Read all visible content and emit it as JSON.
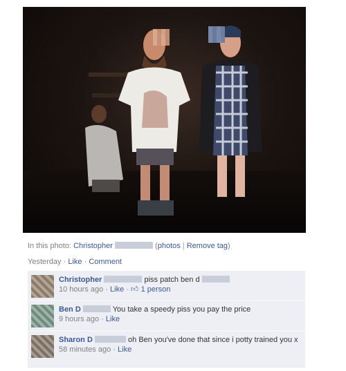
{
  "photo": {
    "alt_tag_caption": "In this photo:",
    "tagged_name": "Christopher",
    "photos_link": "photos",
    "remove_tag_link": "Remove tag"
  },
  "post_actions": {
    "time": "Yesterday",
    "like": "Like",
    "comment": "Comment"
  },
  "comments": [
    {
      "author": "Christopher",
      "text": "piss patch ben d",
      "time": "10 hours ago",
      "like": "Like",
      "like_count": "1 person"
    },
    {
      "author": "Ben D",
      "text": "You take a speedy piss you pay the price",
      "time": "9 hours ago",
      "like": "Like"
    },
    {
      "author": "Sharon D",
      "text": "oh Ben you've done that since i potty trained you x",
      "time": "58 minutes ago",
      "like": "Like"
    }
  ],
  "colors": {
    "link": "#3b5998",
    "comment_bg": "#edeff4",
    "muted": "#808080"
  },
  "icons": {
    "like_count": "thumbs-up-icon"
  }
}
